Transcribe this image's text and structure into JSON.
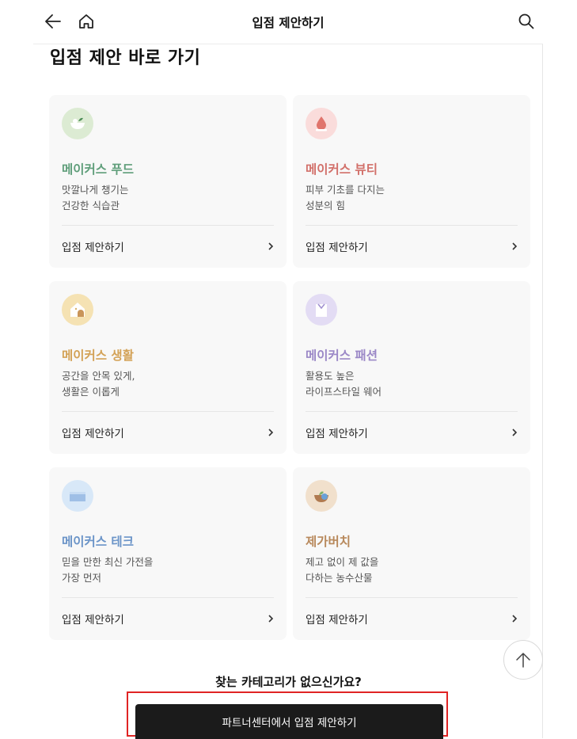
{
  "header": {
    "title": "입점 제안하기",
    "back_icon": "arrow-left-icon",
    "home_icon": "home-icon",
    "search_icon": "search-icon"
  },
  "section_title": "입점 제안 바로 가기",
  "cards": [
    {
      "name": "메이커스 푸드",
      "desc1": "맛깔나게 챙기는",
      "desc2": "건강한 식습관",
      "link": "입점 제안하기",
      "name_color": "#5f9e7a",
      "icon_bg": "#dcebd3",
      "icon": "food-bowl-icon"
    },
    {
      "name": "메이커스 뷰티",
      "desc1": "피부 기초를 다지는",
      "desc2": "성분의 힘",
      "link": "입점 제안하기",
      "name_color": "#d2706a",
      "icon_bg": "#fadcdb",
      "icon": "water-drop-icon"
    },
    {
      "name": "메이커스 생활",
      "desc1": "공간을 안목 있게,",
      "desc2": "생활은 이롭게",
      "link": "입점 제안하기",
      "name_color": "#d3a257",
      "icon_bg": "#f5e2b3",
      "icon": "house-icon"
    },
    {
      "name": "메이커스 패션",
      "desc1": "활용도 높은",
      "desc2": "라이프스타일 웨어",
      "link": "입점 제안하기",
      "name_color": "#9b88c7",
      "icon_bg": "#e3dcf4",
      "icon": "shirt-icon"
    },
    {
      "name": "메이커스 테크",
      "desc1": "믿을 만한 최신 가전을",
      "desc2": "가장 먼저",
      "link": "입점 제안하기",
      "name_color": "#6b94c8",
      "icon_bg": "#d8e8f8",
      "icon": "laptop-icon"
    },
    {
      "name": "제가버치",
      "desc1": "제고 없이 제 값을",
      "desc2": "다하는 농수산물",
      "link": "입점 제안하기",
      "name_color": "#b8895c",
      "icon_bg": "#f1e0cc",
      "icon": "produce-basket-icon"
    }
  ],
  "no_category_text": "찾는 카테고리가 없으신가요?",
  "partner_button_label": "파트너센터에서 입점 제안하기",
  "scroll_top_icon": "arrow-up-icon"
}
